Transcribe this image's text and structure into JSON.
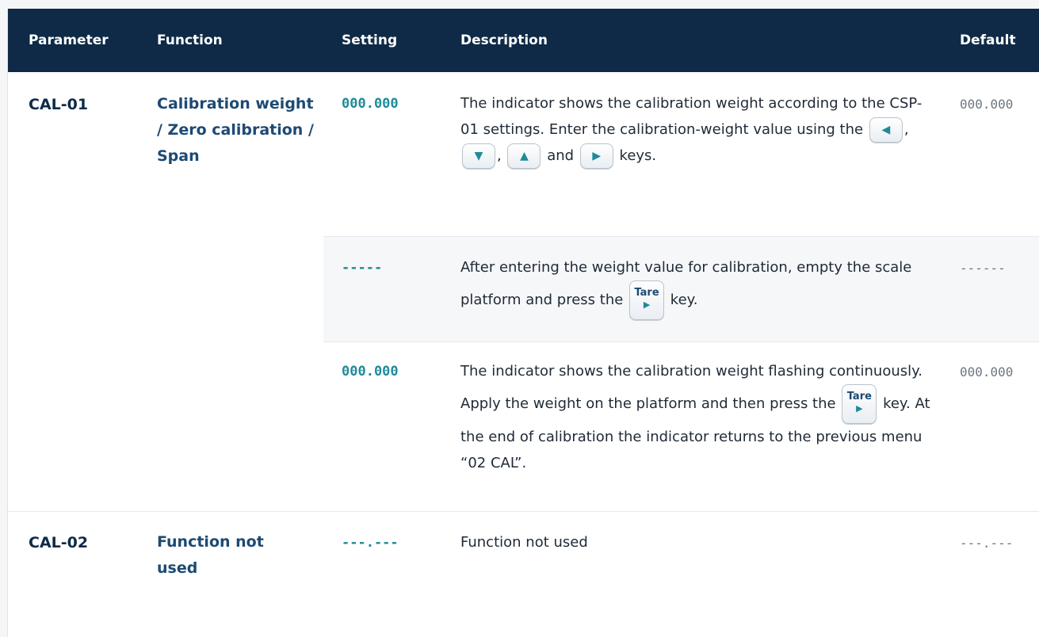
{
  "header": {
    "parameter": "Parameter",
    "function": "Function",
    "setting": "Setting",
    "description": "Description",
    "default": "Default"
  },
  "rows": [
    {
      "parameter": "CAL-01",
      "function": "Calibration weight / Zero calibration / Span",
      "steps": [
        {
          "setting": "000.000",
          "description_parts": [
            "The indicator shows the calibration weight according to the CSP-01 settings. Enter the calibration-weight value using the",
            ",",
            ",",
            "and",
            "keys."
          ],
          "default": "000.000"
        },
        {
          "setting": "-----",
          "description_parts": [
            "After entering the weight value for calibration, empty the scale platform and press the",
            "key."
          ],
          "default": "------"
        },
        {
          "setting": "000.000",
          "description_parts": [
            "The indicator shows the calibration weight flashing continuously. Apply the weight on the platform and then press the",
            "key. At the end of calibration the indicator returns to the previous menu “02 CAL”."
          ],
          "default": "000.000"
        }
      ]
    },
    {
      "parameter": "CAL-02",
      "function": "Function not used",
      "steps": [
        {
          "setting": "---.---",
          "description": "Function not used",
          "default": "---.---"
        }
      ]
    }
  ],
  "keys": {
    "left": "◀",
    "down": "▼",
    "up": "▲",
    "right": "▶",
    "tare_label": "Tare",
    "tare_arrow": "▶"
  },
  "icons": {
    "left": "left-arrow-key-icon",
    "down": "down-arrow-key-icon",
    "up": "up-arrow-key-icon",
    "right": "right-arrow-key-icon",
    "tare": "tare-key-icon"
  },
  "colors": {
    "header_bg": "#0e2a47",
    "accent": "#1f8a99",
    "param_text": "#0e2a47",
    "function_text": "#1d4a73",
    "alt_row_bg": "#f6f7f9"
  }
}
